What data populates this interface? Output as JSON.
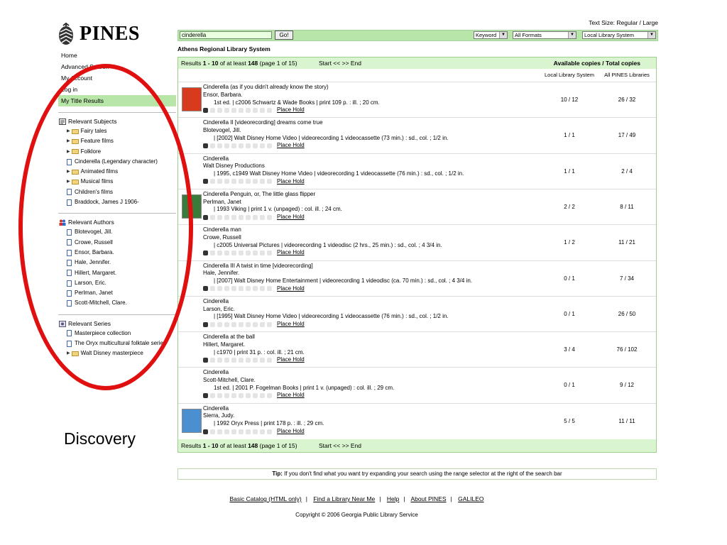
{
  "logo": {
    "text": "PINES"
  },
  "text_size": "Text Size: Regular / Large",
  "search": {
    "value": "cinderella",
    "go_label": "Go!",
    "type_select": "Keyword",
    "format_select": "All Formats",
    "scope_select": "Local Library System"
  },
  "library_name": "Athens Regional Library System",
  "nav": {
    "items": [
      "Home",
      "Advanced Search",
      "My Account",
      "Log in",
      "My Title Results"
    ],
    "subjects_header": "Relevant Subjects",
    "subjects": [
      {
        "label": "Fairy tales",
        "type": "folder"
      },
      {
        "label": "Feature films",
        "type": "folder"
      },
      {
        "label": "Folklore",
        "type": "folder"
      },
      {
        "label": "Cinderella (Legendary character)",
        "type": "doc"
      },
      {
        "label": "Animated films",
        "type": "folder"
      },
      {
        "label": "Musical films",
        "type": "folder"
      },
      {
        "label": "Children's films",
        "type": "doc"
      },
      {
        "label": "Braddock, James J 1906-",
        "type": "doc"
      }
    ],
    "authors_header": "Relevant Authors",
    "authors": [
      "Blotevogel, Jill.",
      "Crowe, Russell",
      "Ensor, Barbara.",
      "Hale, Jennifer.",
      "Hillert, Margaret.",
      "Larson, Eric.",
      "Perlman, Janet",
      "Scott-Mitchell, Clare."
    ],
    "series_header": "Relevant Series",
    "series": [
      {
        "label": "Masterpiece collection",
        "type": "doc"
      },
      {
        "label": "The Oryx multicultural folktale series",
        "type": "doc"
      },
      {
        "label": "Walt Disney masterpiece",
        "type": "folder"
      }
    ]
  },
  "results": {
    "summary_prefix": "Results ",
    "summary_range": "1 - 10",
    "summary_mid": " of at least ",
    "summary_total": "148",
    "summary_page": "  (page 1 of 15)",
    "nav": "Start  <<  >> End",
    "copies_header": "Available copies / Total copies",
    "col_local": "Local Library System",
    "col_all": "All PINES Libraries",
    "place_hold": "Place Hold",
    "rows": [
      {
        "title": "Cinderella (as if you didn't already know the story)",
        "author": "Ensor, Barbara.",
        "details": "1st ed. | c2006 Schwartz & Wade Books | print 109 p. : ill. ; 20 cm.",
        "local": "10 / 12",
        "all": "26 / 32",
        "thumb": "#d83a1e"
      },
      {
        "title": "Cinderella II [videorecording] dreams come true",
        "author": "Blotevogel, Jill.",
        "details": "| [2002] Walt Disney Home Video | videorecording 1 videocassette (73 min.) : sd., col. ; 1/2 in.",
        "local": "1 / 1",
        "all": "17 / 49",
        "thumb": ""
      },
      {
        "title": "Cinderella",
        "author": "Walt Disney Productions",
        "details": "| 1995, c1949 Walt Disney Home Video | videorecording 1 videocassette (76 min.) : sd., col. ; 1/2 in.",
        "local": "1 / 1",
        "all": "2 / 4",
        "thumb": ""
      },
      {
        "title": "Cinderella Penguin, or, The little glass flipper",
        "author": "Perlman, Janet",
        "details": "| 1993 Viking | print 1 v. (unpaged) : col. ill. ; 24 cm.",
        "local": "2 / 2",
        "all": "8 / 11",
        "thumb": "#3a7a3a"
      },
      {
        "title": "Cinderella man",
        "author": "Crowe, Russell",
        "details": "| c2005 Universal Pictures | videorecording 1 videodisc (2 hrs., 25 min.) : sd., col. ; 4 3/4 in.",
        "local": "1 / 2",
        "all": "11 / 21",
        "thumb": ""
      },
      {
        "title": "Cinderella III A twist in time [videorecording]",
        "author": "Hale, Jennifer.",
        "details": "| [2007] Walt Disney Home Entertainment | videorecording 1 videodisc (ca. 70 min.) : sd., col. ; 4 3/4 in.",
        "local": "0 / 1",
        "all": "7 / 34",
        "thumb": ""
      },
      {
        "title": "Cinderella",
        "author": "Larson, Eric.",
        "details": "| [1995] Walt Disney Home Video | videorecording 1 videocassette (76 min.) : sd., col. ; 1/2 in.",
        "local": "0 / 1",
        "all": "26 / 50",
        "thumb": ""
      },
      {
        "title": "Cinderella at the ball",
        "author": "Hillert, Margaret.",
        "details": "| c1970 | print 31 p. : col. ill. ; 21 cm.",
        "local": "3 / 4",
        "all": "76 / 102",
        "thumb": ""
      },
      {
        "title": "Cinderella",
        "author": "Scott-Mitchell, Clare.",
        "details": "1st ed. | 2001 P. Fogelman Books | print 1 v. (unpaged) : col. ill. ; 29 cm.",
        "local": "0 / 1",
        "all": "9 / 12",
        "thumb": ""
      },
      {
        "title": "Cinderella",
        "author": "Sierra, Judy.",
        "details": "| 1992 Oryx Press | print 178 p. : ill. ; 29 cm.",
        "local": "5 / 5",
        "all": "11 / 11",
        "thumb": "#4a8fd0"
      }
    ]
  },
  "tip": {
    "label": "Tip:",
    "text": " If you don't find what you want try expanding your search using the range selector at the right of the search bar"
  },
  "footer": {
    "links": [
      "Basic Catalog (HTML only)",
      "Find a Library Near Me",
      "Help",
      "About PINES",
      "GALILEO"
    ],
    "copyright": "Copyright © 2006 Georgia Public Library Service"
  },
  "annotation": {
    "label": "Discovery",
    "color": "#e01010"
  }
}
